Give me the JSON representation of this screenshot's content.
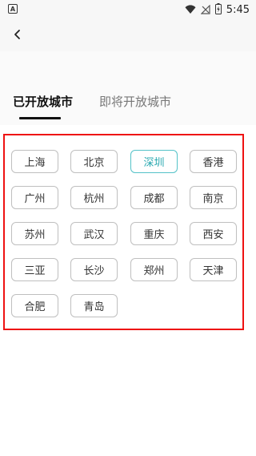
{
  "status_bar": {
    "time": "5:45",
    "app_icon_glyph": "A",
    "icons": [
      "wifi-icon",
      "signal-off-icon",
      "battery-charging-icon"
    ]
  },
  "header": {
    "back_icon": "chevron-left-icon"
  },
  "tabs": [
    {
      "label": "已开放城市",
      "active": true
    },
    {
      "label": "即将开放城市",
      "active": false
    }
  ],
  "cities": [
    {
      "name": "上海",
      "selected": false
    },
    {
      "name": "北京",
      "selected": false
    },
    {
      "name": "深圳",
      "selected": true
    },
    {
      "name": "香港",
      "selected": false
    },
    {
      "name": "广州",
      "selected": false
    },
    {
      "name": "杭州",
      "selected": false
    },
    {
      "name": "成都",
      "selected": false
    },
    {
      "name": "南京",
      "selected": false
    },
    {
      "name": "苏州",
      "selected": false
    },
    {
      "name": "武汉",
      "selected": false
    },
    {
      "name": "重庆",
      "selected": false
    },
    {
      "name": "西安",
      "selected": false
    },
    {
      "name": "三亚",
      "selected": false
    },
    {
      "name": "长沙",
      "selected": false
    },
    {
      "name": "郑州",
      "selected": false
    },
    {
      "name": "天津",
      "selected": false
    },
    {
      "name": "合肥",
      "selected": false
    },
    {
      "name": "青岛",
      "selected": false
    }
  ],
  "colors": {
    "panel_border": "#ee1111",
    "selected_accent": "#54c2c8",
    "button_border": "#bfbfbf"
  }
}
